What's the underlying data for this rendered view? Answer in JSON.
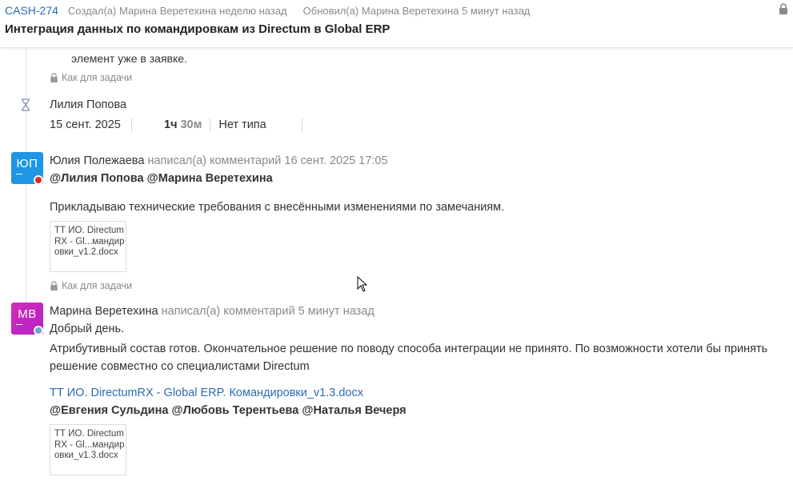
{
  "header": {
    "task_key": "CASH-274",
    "created": "Создал(а) Марина Веретехина неделю назад",
    "updated": "Обновил(а) Марина Веретехина 5 минут назад",
    "title": "Интеграция данных по командировкам из Directum в Global ERP"
  },
  "prev": {
    "cut_text": "элемент уже в заявке.",
    "scope": "Как для задачи"
  },
  "worklog": {
    "user": "Лилия Попова",
    "date": "15 сент. 2025",
    "hours": "1ч",
    "minutes": "30м",
    "type": "Нет типа"
  },
  "comments": [
    {
      "initials": "ЮП",
      "author": "Юлия Полежаева",
      "action": "написал(а) комментарий 16 сент. 2025 17:05",
      "mentions": "@Лилия Попова @Марина Веретехина",
      "text": "Прикладываю технические требования с внесёнными изменениями по замечаниям.",
      "attachment": "ТТ ИО. DirectumRX - Gl...мандировки_v1.2.docx",
      "scope": "Как для задачи"
    },
    {
      "initials": "МВ",
      "author": "Марина Веретехина",
      "action": "написал(а) комментарий 5 минут назад",
      "greeting": "Добрый день.",
      "text": "Атрибутивный состав готов. Окончательное решение по поводу способа интеграции не принято. По возможности хотели бы принять решение совместно со специалистами Directum",
      "link": "ТТ ИО. DirectumRX - Global ERP. Командировки_v1.3.docx",
      "mentions": "@Евгения Сульдина @Любовь Терентьева @Наталья Вечеря",
      "attachment": "ТТ ИО. DirectumRX - Gl...мандировки_v1.3.docx"
    }
  ],
  "colors": {
    "link": "#2c6cb5",
    "avatar_yp": "#1e96e5",
    "avatar_mv": "#c726c0",
    "muted": "#8a8a8a"
  },
  "icons": [
    "lock-icon",
    "hourglass-icon",
    "cursor-icon"
  ]
}
